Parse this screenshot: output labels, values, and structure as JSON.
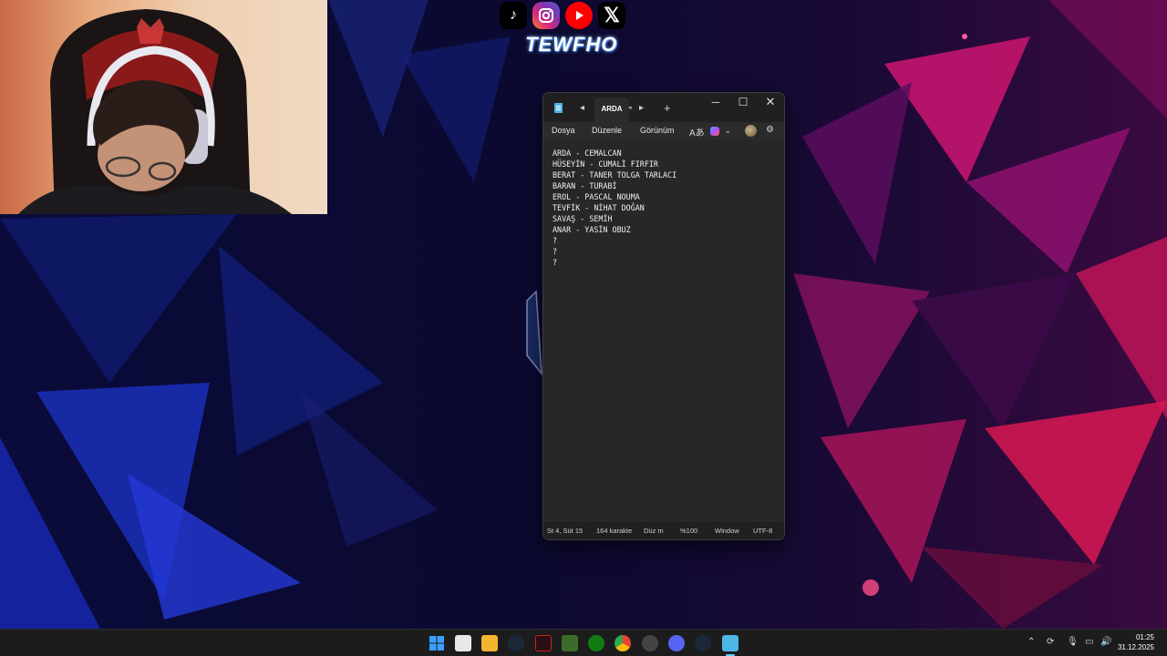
{
  "social": {
    "icons": [
      "tiktok-icon",
      "instagram-icon",
      "youtube-icon",
      "x-icon"
    ],
    "channel_name": "TEWFHO"
  },
  "notepad": {
    "tab_title": "ARDA",
    "new_tab_label": "+",
    "menu": {
      "file": "Dosya",
      "edit": "Düzenle",
      "view": "Görünüm"
    },
    "lines": [
      "ARDA - CEMALCAN",
      "HÜSEYİN - CUMALİ FIRFIR",
      "BERAT - TANER TOLGA TARLACI",
      "BARAN - TURABİ",
      "EROL - PASCAL NOUMA",
      "TEVFİK - NİHAT DOĞAN",
      "SAVAŞ - SEMİH",
      "ANAR - YASİN OBUZ",
      "?",
      "?",
      "?"
    ],
    "status": {
      "position": "St 4, Süt 15",
      "chars": "164 karakte",
      "mode": "Düz m",
      "zoom": "%100",
      "line_ending": "Window",
      "encoding": "UTF-8"
    }
  },
  "taskbar": {
    "clock_time": "01:25",
    "clock_date": "31.12.2025",
    "accent": "#60cdff"
  }
}
